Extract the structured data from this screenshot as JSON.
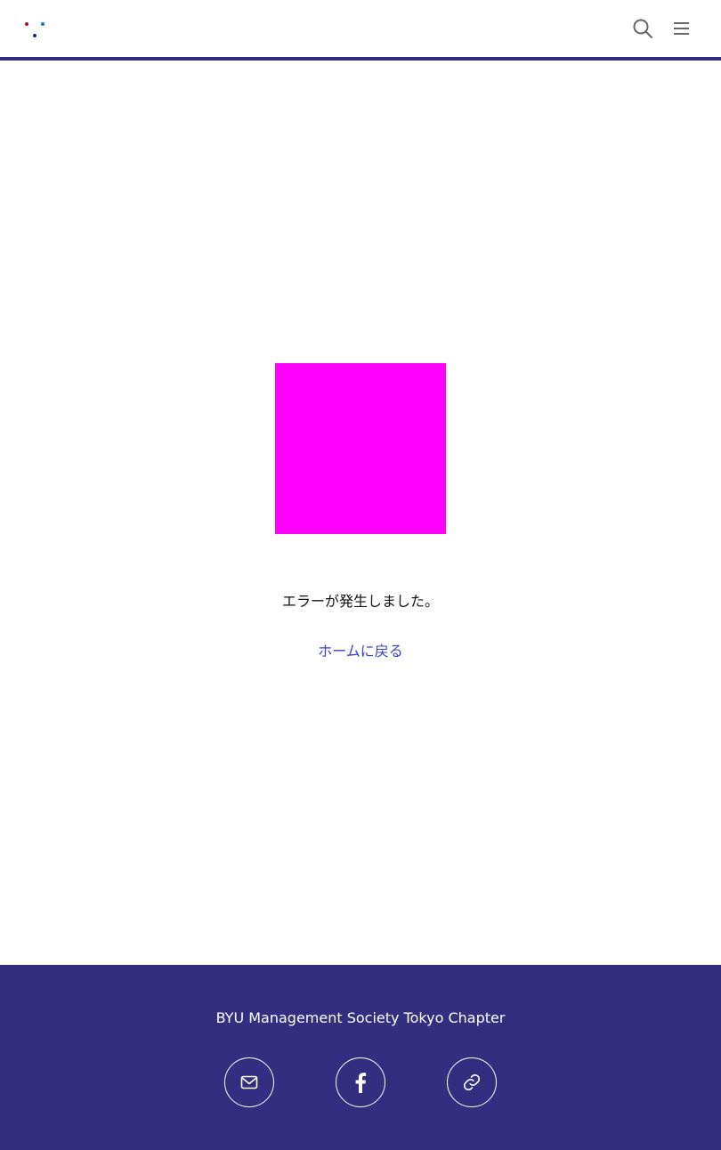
{
  "header": {
    "logo": "byu-management-society-logo",
    "search_icon": "search-icon",
    "menu_icon": "hamburger-menu-icon",
    "border_color": "#332e80"
  },
  "main": {
    "error_image_color": "#ff00ff",
    "error_message": "エラーが発生しました。",
    "home_link": "ホームに戻る",
    "link_color": "#3a3ecb"
  },
  "footer": {
    "title": "BYU Management Society Tokyo Chapter",
    "background": "#332e80",
    "social": [
      {
        "icon": "mail-icon"
      },
      {
        "icon": "facebook-icon"
      },
      {
        "icon": "link-icon"
      }
    ]
  }
}
